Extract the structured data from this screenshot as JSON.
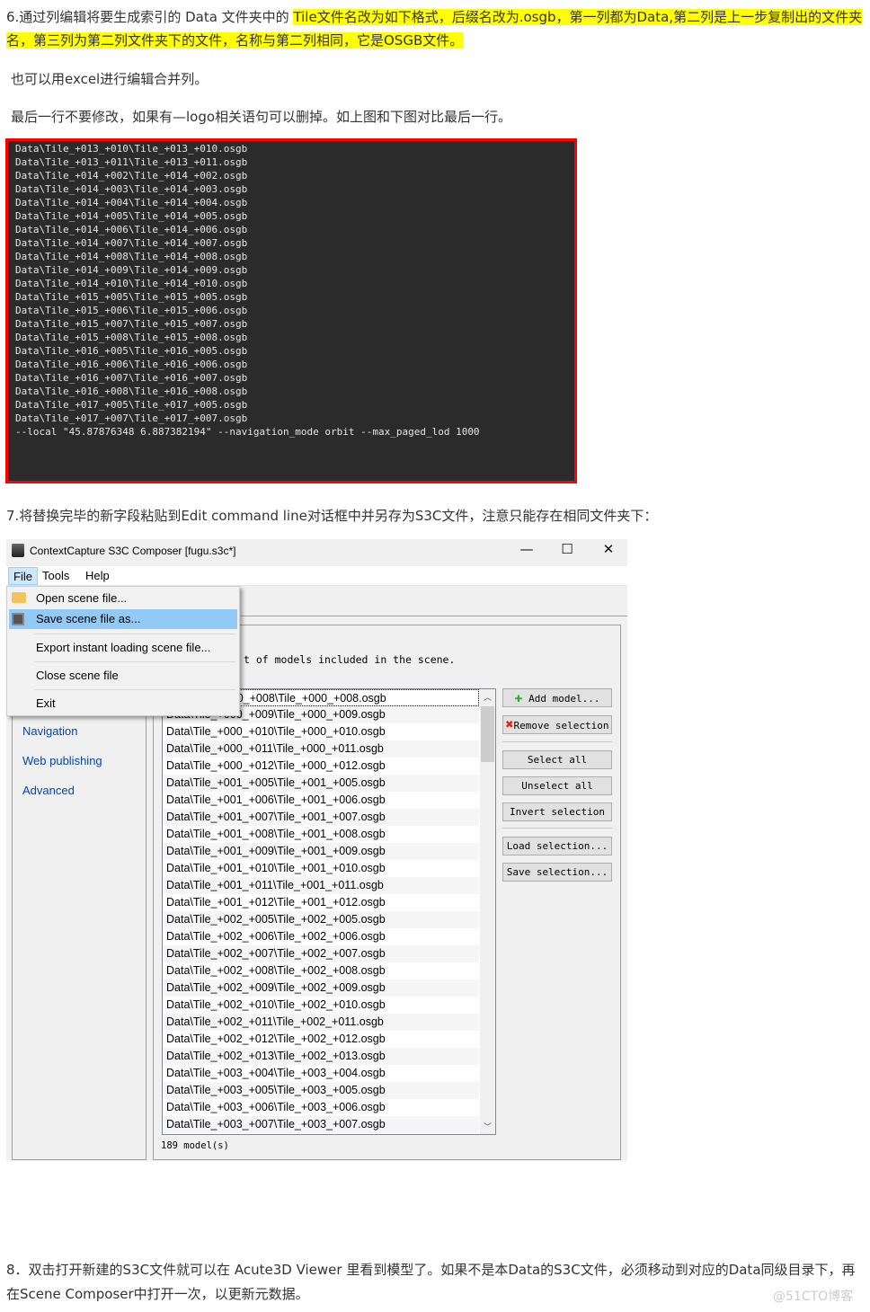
{
  "article": {
    "step6_plain": "6.通过列编辑将要生成索引的 Data 文件夹中的 ",
    "step6_highlight": "Tile文件名改为如下格式，后缀名改为.osgb，第一列都为Data,第二列是上一步复制出的文件夹名，第三列为第二列文件夹下的文件，名称与第二列相同，它是OSGB文件。",
    "excel_note": "也可以用excel进行编辑合并列。",
    "last_line_note": "最后一行不要修改，如果有—logo相关语句可以删掉。如上图和下图对比最后一行。",
    "step7": "7.将替换完毕的新字段粘贴到Edit command line对话框中并另存为S3C文件，注意只能存在相同文件夹下：",
    "step8": "8．双击打开新建的S3C文件就可以在 Acute3D Viewer 里看到模型了。如果不是本Data的S3C文件，必须移动到对应的Data同级目录下，再在Scene Composer中打开一次，以更新元数据。",
    "watermark": "@51CTO博客"
  },
  "console": {
    "lines": [
      "Data\\Tile_+013_+010\\Tile_+013_+010.osgb",
      "Data\\Tile_+013_+011\\Tile_+013_+011.osgb",
      "Data\\Tile_+014_+002\\Tile_+014_+002.osgb",
      "Data\\Tile_+014_+003\\Tile_+014_+003.osgb",
      "Data\\Tile_+014_+004\\Tile_+014_+004.osgb",
      "Data\\Tile_+014_+005\\Tile_+014_+005.osgb",
      "Data\\Tile_+014_+006\\Tile_+014_+006.osgb",
      "Data\\Tile_+014_+007\\Tile_+014_+007.osgb",
      "Data\\Tile_+014_+008\\Tile_+014_+008.osgb",
      "Data\\Tile_+014_+009\\Tile_+014_+009.osgb",
      "Data\\Tile_+014_+010\\Tile_+014_+010.osgb",
      "Data\\Tile_+015_+005\\Tile_+015_+005.osgb",
      "Data\\Tile_+015_+006\\Tile_+015_+006.osgb",
      "Data\\Tile_+015_+007\\Tile_+015_+007.osgb",
      "Data\\Tile_+015_+008\\Tile_+015_+008.osgb",
      "Data\\Tile_+016_+005\\Tile_+016_+005.osgb",
      "Data\\Tile_+016_+006\\Tile_+016_+006.osgb",
      "Data\\Tile_+016_+007\\Tile_+016_+007.osgb",
      "Data\\Tile_+016_+008\\Tile_+016_+008.osgb",
      "Data\\Tile_+017_+005\\Tile_+017_+005.osgb",
      "Data\\Tile_+017_+007\\Tile_+017_+007.osgb",
      "--local \"45.87876348 6.887382194\" --navigation_mode orbit --max_paged_lod 1000"
    ]
  },
  "window": {
    "title": "ContextCapture S3C Composer [fugu.s3c*]",
    "controls": {
      "minimize": "—",
      "maximize": "☐",
      "close": "✕"
    },
    "menubar": [
      "File",
      "Tools",
      "Help"
    ],
    "file_menu": [
      "Open scene file...",
      "Save scene file as...",
      "Export instant loading scene file...",
      "Close scene file",
      "Exit"
    ],
    "sidebar": [
      "Navigation",
      "Web publishing",
      "Advanced"
    ],
    "description": "t of models included in the scene.",
    "models": [
      "Data\\Tile_+000_+008\\Tile_+000_+008.osgb",
      "Data\\Tile_+000_+009\\Tile_+000_+009.osgb",
      "Data\\Tile_+000_+010\\Tile_+000_+010.osgb",
      "Data\\Tile_+000_+011\\Tile_+000_+011.osgb",
      "Data\\Tile_+000_+012\\Tile_+000_+012.osgb",
      "Data\\Tile_+001_+005\\Tile_+001_+005.osgb",
      "Data\\Tile_+001_+006\\Tile_+001_+006.osgb",
      "Data\\Tile_+001_+007\\Tile_+001_+007.osgb",
      "Data\\Tile_+001_+008\\Tile_+001_+008.osgb",
      "Data\\Tile_+001_+009\\Tile_+001_+009.osgb",
      "Data\\Tile_+001_+010\\Tile_+001_+010.osgb",
      "Data\\Tile_+001_+011\\Tile_+001_+011.osgb",
      "Data\\Tile_+001_+012\\Tile_+001_+012.osgb",
      "Data\\Tile_+002_+005\\Tile_+002_+005.osgb",
      "Data\\Tile_+002_+006\\Tile_+002_+006.osgb",
      "Data\\Tile_+002_+007\\Tile_+002_+007.osgb",
      "Data\\Tile_+002_+008\\Tile_+002_+008.osgb",
      "Data\\Tile_+002_+009\\Tile_+002_+009.osgb",
      "Data\\Tile_+002_+010\\Tile_+002_+010.osgb",
      "Data\\Tile_+002_+011\\Tile_+002_+011.osgb",
      "Data\\Tile_+002_+012\\Tile_+002_+012.osgb",
      "Data\\Tile_+002_+013\\Tile_+002_+013.osgb",
      "Data\\Tile_+003_+004\\Tile_+003_+004.osgb",
      "Data\\Tile_+003_+005\\Tile_+003_+005.osgb",
      "Data\\Tile_+003_+006\\Tile_+003_+006.osgb",
      "Data\\Tile_+003_+007\\Tile_+003_+007.osgb"
    ],
    "buttons": [
      "Add model...",
      "Remove selection",
      "Select all",
      "Unselect all",
      "Invert selection",
      "Load selection...",
      "Save selection..."
    ],
    "model_count": "189 model(s)"
  },
  "colors": {
    "highlight": "#ffff00",
    "console_border": "#ff0000",
    "menu_hover": "#91c9f7",
    "link": "#0645ad"
  }
}
